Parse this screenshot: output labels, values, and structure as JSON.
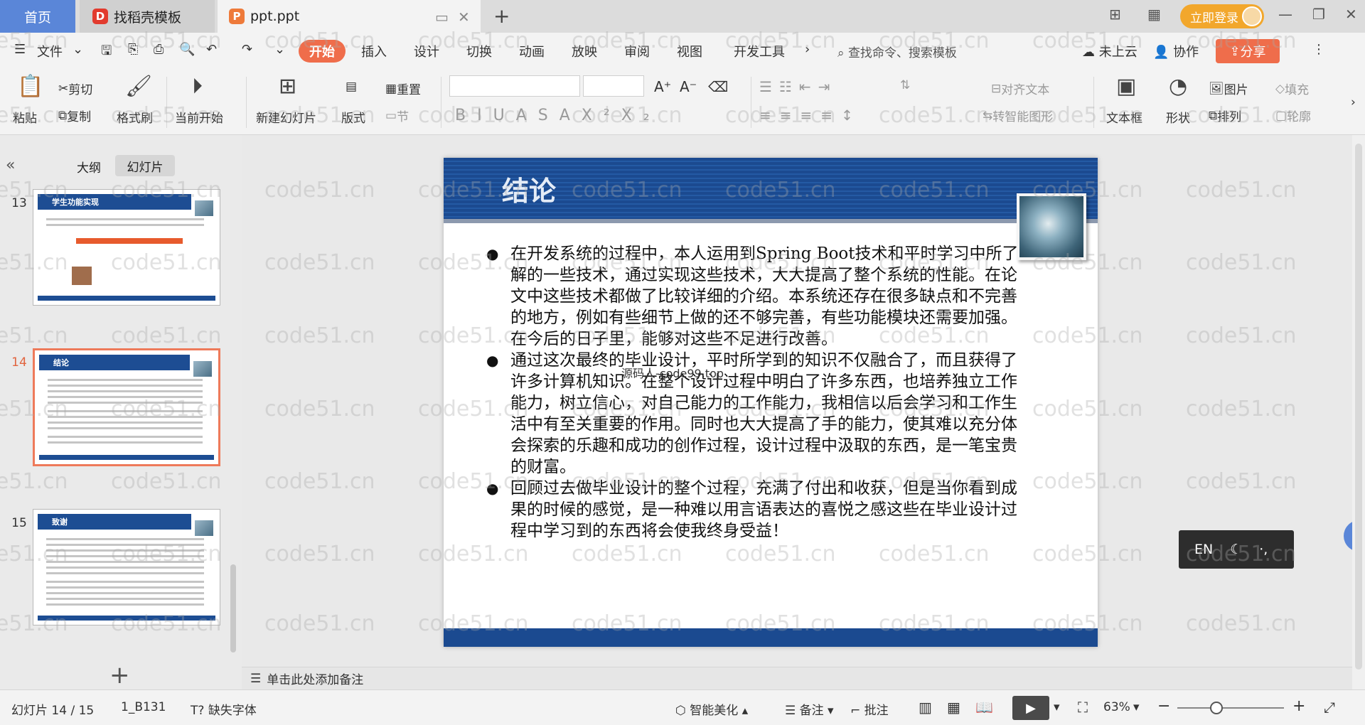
{
  "tabs": {
    "home": "首页",
    "template": "找稻壳模板",
    "document": "ppt.ppt"
  },
  "titlebar": {
    "login": "立即登录"
  },
  "menu": {
    "file": "文件",
    "items": [
      "开始",
      "插入",
      "设计",
      "切换",
      "动画",
      "放映",
      "审阅",
      "视图",
      "开发工具"
    ],
    "search": "查找命令、搜索模板",
    "cloud": "未上云",
    "collab": "协作",
    "share": "分享"
  },
  "ribbon": {
    "paste": "粘贴",
    "cut": "剪切",
    "copy": "复制",
    "format_painter": "格式刷",
    "from_current": "当前开始",
    "new_slide": "新建幻灯片",
    "layout": "版式",
    "section": "节",
    "reset": "重置",
    "align_text": "对齐文本",
    "smart_art": "转智能图形",
    "textbox": "文本框",
    "shape": "形状",
    "arrange": "排列",
    "picture": "图片",
    "fill": "填充",
    "outline": "轮廓"
  },
  "panel": {
    "outline_tab": "大纲",
    "slides_tab": "幻灯片",
    "thumbnails": [
      {
        "num": "13",
        "title": "学生功能实现"
      },
      {
        "num": "14",
        "title": "结论"
      },
      {
        "num": "15",
        "title": "致谢"
      }
    ]
  },
  "slide": {
    "title": "结论",
    "bullets": [
      "在开发系统的过程中，本人运用到Spring Boot技术和平时学习中所了解的一些技术，通过实现这些技术，大大提高了整个系统的性能。在论文中这些技术都做了比较详细的介绍。本系统还存在很多缺点和不完善的地方，例如有些细节上做的还不够完善，有些功能模块还需要加强。在今后的日子里，能够对这些不足进行改善。",
      "通过这次最终的毕业设计，平时所学到的知识不仅融合了，而且获得了许多计算机知识。在整个设计过程中明白了许多东西，也培养独立工作能力，树立信心，对自己能力的工作能力，我相信以后会学习和工作生活中有至关重要的作用。同时也大大提高了手的能力，使其难以充分体会探索的乐趣和成功的创作过程，设计过程中汲取的东西，是一笔宝贵的财富。",
      "回顾过去做毕业设计的整个过程，充满了付出和收获，但是当你看到成果的时候的感觉，是一种难以用言语表达的喜悦之感这些在毕业设计过程中学习到的东西将会使我终身受益！"
    ],
    "overlay_watermark": "源码人-code99.top"
  },
  "notes_placeholder": "单击此处添加备注",
  "ime": {
    "lang": "EN"
  },
  "watermark_text": "code51.cn",
  "status": {
    "slide_counter": "幻灯片 14 / 15",
    "theme": "1_B131",
    "missing_font": "缺失字体",
    "beautify": "智能美化",
    "notes": "备注",
    "comments": "批注",
    "zoom": "63%"
  }
}
